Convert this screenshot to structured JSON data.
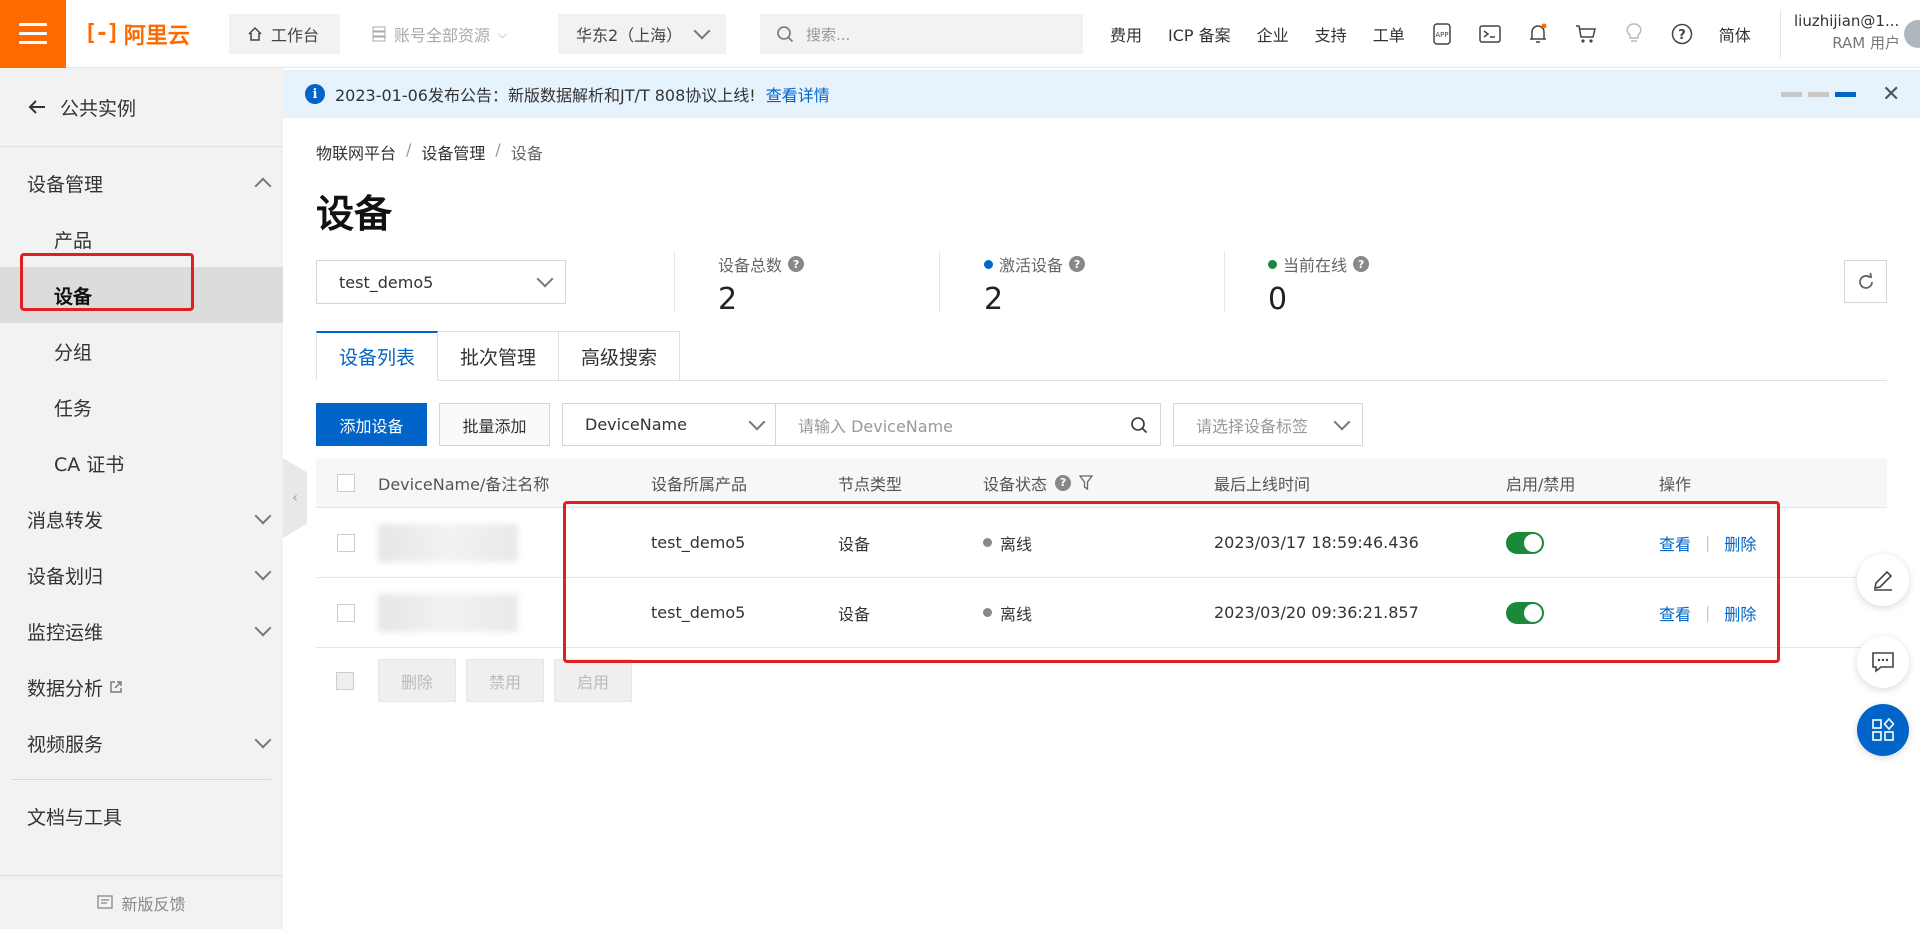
{
  "topbar": {
    "logo": "阿里云",
    "workbench": "工作台",
    "resources": "账号全部资源",
    "region": "华东2（上海）",
    "search_placeholder": "搜索...",
    "links": [
      "费用",
      "ICP 备案",
      "企业",
      "支持",
      "工单"
    ],
    "lang": "简体",
    "user_name": "liuzhijian@1...",
    "user_role": "RAM 用户"
  },
  "sidebar": {
    "back": "公共实例",
    "group_device": "设备管理",
    "sub_items": [
      "产品",
      "设备",
      "分组",
      "任务",
      "CA 证书"
    ],
    "groups": [
      "消息转发",
      "设备划归",
      "监控运维",
      "数据分析",
      "视频服务"
    ],
    "docs": "文档与工具",
    "feedback": "新版反馈"
  },
  "notice": {
    "text": "2023-01-06发布公告：新版数据解析和JT/T 808协议上线!",
    "link": "查看详情"
  },
  "breadcrumb": [
    "物联网平台",
    "设备管理",
    "设备"
  ],
  "page_title": "设备",
  "product_select": "test_demo5",
  "stats": [
    {
      "label": "设备总数",
      "value": "2"
    },
    {
      "label": "激活设备",
      "value": "2"
    },
    {
      "label": "当前在线",
      "value": "0"
    }
  ],
  "tabs": [
    "设备列表",
    "批次管理",
    "高级搜索"
  ],
  "toolbar": {
    "add": "添加设备",
    "batch_add": "批量添加",
    "field": "DeviceName",
    "input_placeholder": "请输入 DeviceName",
    "tag_placeholder": "请选择设备标签"
  },
  "table": {
    "headers": [
      "DeviceName/备注名称",
      "设备所属产品",
      "节点类型",
      "设备状态",
      "最后上线时间",
      "启用/禁用",
      "操作"
    ],
    "rows": [
      {
        "product": "test_demo5",
        "node": "设备",
        "status": "离线",
        "time": "2023/03/17 18:59:46.436",
        "view": "查看",
        "delete": "删除"
      },
      {
        "product": "test_demo5",
        "node": "设备",
        "status": "离线",
        "time": "2023/03/20 09:36:21.857",
        "view": "查看",
        "delete": "删除"
      }
    ]
  },
  "bulk": [
    "删除",
    "禁用",
    "启用"
  ],
  "colors": {
    "accent": "#0064c8",
    "brand": "#ff6a00",
    "active_dot": "#0064c8",
    "online_dot": "#1a8a3a",
    "switch_on": "#1a8a3a",
    "highlight": "#e02020"
  }
}
